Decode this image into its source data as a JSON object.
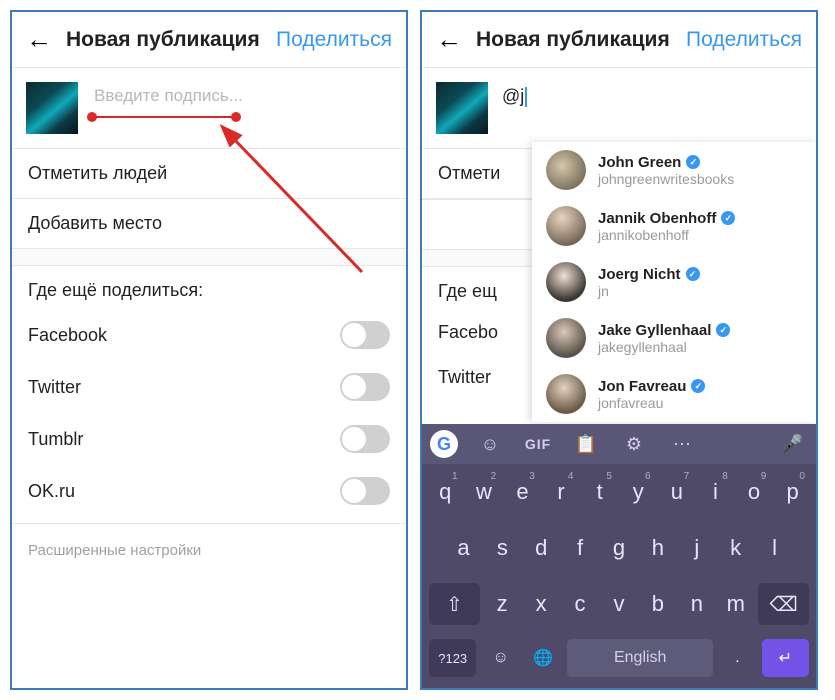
{
  "left": {
    "header_title": "Новая публикация",
    "share": "Поделиться",
    "caption_placeholder": "Введите подпись...",
    "tag_people": "Отметить людей",
    "add_location": "Добавить место",
    "also_share": "Где ещё поделиться:",
    "networks": [
      "Facebook",
      "Twitter",
      "Tumblr",
      "OK.ru"
    ],
    "advanced": "Расширенные настройки"
  },
  "right": {
    "header_title": "Новая публикация",
    "share": "Поделиться",
    "caption_text": "@j",
    "tag_people_partial": "Отмети",
    "also_share_partial": "Где ещ",
    "networks_partial": [
      "Facebo",
      "Twitter"
    ],
    "suggestions": [
      {
        "name": "John Green",
        "username": "johngreenwritesbooks"
      },
      {
        "name": "Jannik Obenhoff",
        "username": "jannikobenhoff"
      },
      {
        "name": "Joerg Nicht",
        "username": "jn"
      },
      {
        "name": "Jake Gyllenhaal",
        "username": "jakegyllenhaal"
      },
      {
        "name": "Jon Favreau",
        "username": "jonfavreau"
      }
    ]
  },
  "keyboard": {
    "gif": "GIF",
    "row1": [
      {
        "l": "q",
        "n": "1"
      },
      {
        "l": "w",
        "n": "2"
      },
      {
        "l": "e",
        "n": "3"
      },
      {
        "l": "r",
        "n": "4"
      },
      {
        "l": "t",
        "n": "5"
      },
      {
        "l": "y",
        "n": "6"
      },
      {
        "l": "u",
        "n": "7"
      },
      {
        "l": "i",
        "n": "8"
      },
      {
        "l": "o",
        "n": "9"
      },
      {
        "l": "p",
        "n": "0"
      }
    ],
    "row2": [
      "a",
      "s",
      "d",
      "f",
      "g",
      "h",
      "j",
      "k",
      "l"
    ],
    "row3": [
      "z",
      "x",
      "c",
      "v",
      "b",
      "n",
      "m"
    ],
    "num_toggle": "?123",
    "spacebar": "English",
    "comma": ",",
    "period": "."
  }
}
